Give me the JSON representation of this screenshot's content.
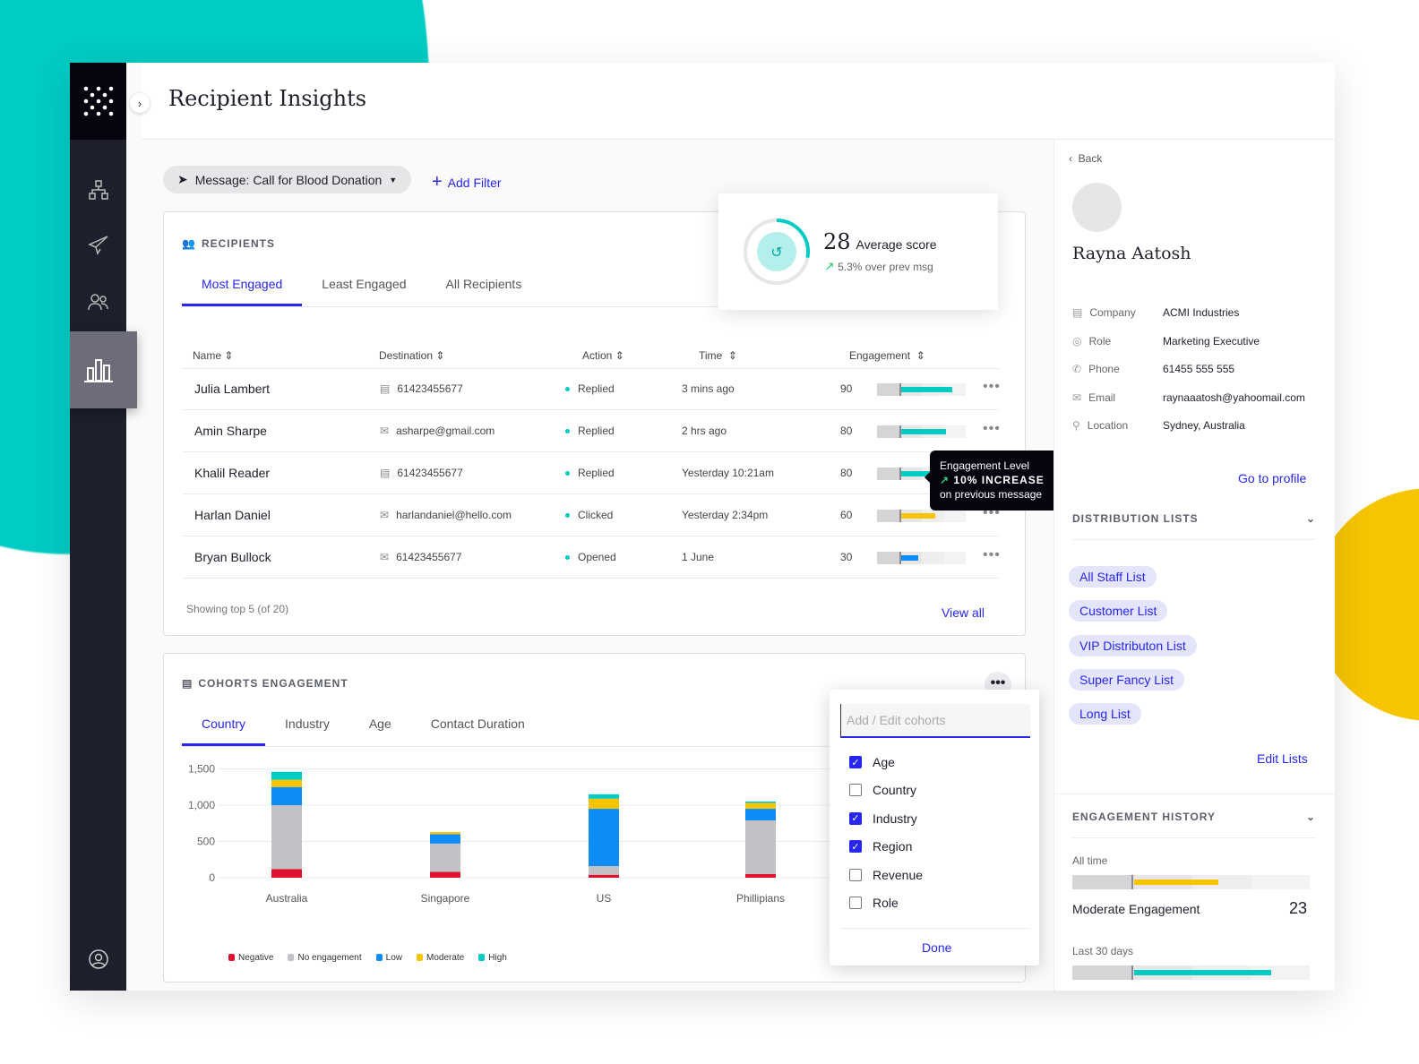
{
  "header": {
    "title": "Recipient Insights"
  },
  "filter": {
    "message": "Message: Call for Blood Donation",
    "add_filter": "Add Filter"
  },
  "score": {
    "value": "28",
    "label": "Average score",
    "delta": "5.3% over prev msg"
  },
  "recipients": {
    "title": "RECIPIENTS",
    "tabs": [
      "Most Engaged",
      "Least Engaged",
      "All Recipients"
    ],
    "columns": [
      "Name",
      "Destination",
      "Action",
      "Time",
      "Engagement"
    ],
    "rows": [
      {
        "name": "Julia Lambert",
        "dest": "61423455677",
        "dest_type": "sms",
        "action": "Replied",
        "time": "3 mins ago",
        "engagement": 90,
        "eng_label": "90",
        "color": "#00cbc3"
      },
      {
        "name": "Amin Sharpe",
        "dest": "asharpe@gmail.com",
        "dest_type": "email",
        "action": "Replied",
        "time": "2 hrs ago",
        "engagement": 80,
        "eng_label": "80",
        "color": "#00cbc3"
      },
      {
        "name": "Khalil Reader",
        "dest": "61423455677",
        "dest_type": "sms",
        "action": "Replied",
        "time": "Yesterday 10:21am",
        "engagement": 80,
        "eng_label": "80",
        "color": "#00cbc3"
      },
      {
        "name": "Harlan Daniel",
        "dest": "harlandaniel@hello.com",
        "dest_type": "email",
        "action": "Clicked",
        "time": "Yesterday 2:34pm",
        "engagement": 60,
        "eng_label": "60",
        "color": "#f6c400"
      },
      {
        "name": "Bryan Bullock",
        "dest": "61423455677",
        "dest_type": "email",
        "action": "Opened",
        "time": "1 June",
        "engagement": 30,
        "eng_label": "30",
        "color": "#0d8cf5"
      }
    ],
    "footer": "Showing top 5 (of 20)",
    "view_all": "View all"
  },
  "tooltip": {
    "line1": "Engagement Level",
    "line2": "10% INCREASE",
    "line3": "on previous message"
  },
  "cohorts": {
    "title": "COHORTS ENGAGEMENT",
    "tabs": [
      "Country",
      "Industry",
      "Age",
      "Contact Duration"
    ]
  },
  "chart_data": {
    "type": "bar",
    "stacked": true,
    "categories": [
      "Australia",
      "Singapore",
      "US",
      "Phillipians"
    ],
    "series": [
      {
        "name": "Negative",
        "color": "#e0102f",
        "values": [
          120,
          80,
          40,
          50
        ]
      },
      {
        "name": "No engagement",
        "color": "#c2c2c6",
        "values": [
          880,
          390,
          120,
          740
        ]
      },
      {
        "name": "Low",
        "color": "#0d8cf5",
        "values": [
          250,
          130,
          790,
          160
        ]
      },
      {
        "name": "Moderate",
        "color": "#f6c400",
        "values": [
          100,
          30,
          140,
          80
        ]
      },
      {
        "name": "High",
        "color": "#00cbc3",
        "values": [
          110,
          0,
          60,
          20
        ]
      }
    ],
    "yticks": [
      "0",
      "500",
      "1,000",
      "1,500",
      "2,000"
    ],
    "ylim": [
      0,
      2000
    ],
    "legend": "bottom",
    "grid": true
  },
  "cohort_menu": {
    "placeholder": "Add / Edit cohorts",
    "options": [
      {
        "label": "Age",
        "checked": true
      },
      {
        "label": "Country",
        "checked": false
      },
      {
        "label": "Industry",
        "checked": true
      },
      {
        "label": "Region",
        "checked": true
      },
      {
        "label": "Revenue",
        "checked": false
      },
      {
        "label": "Role",
        "checked": false
      }
    ],
    "done": "Done"
  },
  "profile": {
    "back": "Back",
    "name": "Rayna Aatosh",
    "fields": [
      {
        "label": "Company",
        "value": "ACMI Industries"
      },
      {
        "label": "Role",
        "value": "Marketing Executive"
      },
      {
        "label": "Phone",
        "value": "61455 555 555"
      },
      {
        "label": "Email",
        "value": "raynaaatosh@yahoomail.com"
      },
      {
        "label": "Location",
        "value": "Sydney, Australia"
      }
    ],
    "go_profile": "Go to profile",
    "dist_title": "DISTRIBUTION LISTS",
    "lists": [
      "All Staff List",
      "Customer List",
      "VIP Distributon List",
      "Super Fancy List",
      "Long List"
    ],
    "edit_lists": "Edit Lists",
    "hist_title": "ENGAGEMENT HISTORY",
    "all_time": "All time",
    "all_time_value": 0.55,
    "moderate": "Moderate Engagement",
    "moderate_score": "23",
    "last30": "Last 30 days",
    "last30_value": 0.78
  }
}
